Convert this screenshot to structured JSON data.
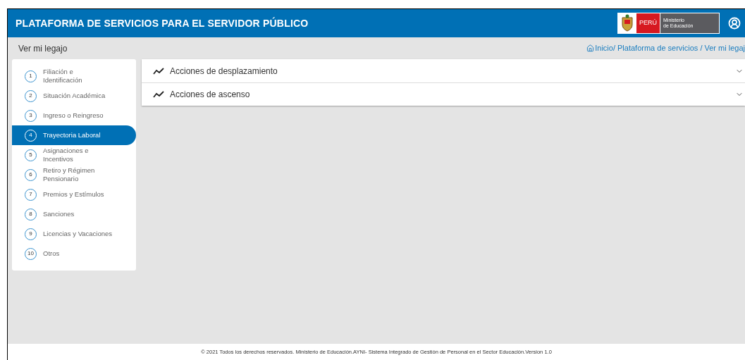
{
  "header": {
    "title": "PLATAFORMA DE SERVICIOS PARA EL SERVIDOR PÚBLICO",
    "logo": {
      "country": "PERÚ",
      "ministry_line_1": "Ministerio",
      "ministry_line_2": "de Educación"
    }
  },
  "subheader": {
    "title": "Ver mi legajo",
    "breadcrumb": "Inicio/ Plataforma de servicios / Ver mi legaj"
  },
  "sidebar": {
    "items": [
      {
        "number": "1",
        "label": "Filiación e Identificación",
        "selected": false
      },
      {
        "number": "2",
        "label": "Situación Académica",
        "selected": false
      },
      {
        "number": "3",
        "label": "Ingreso o Reingreso",
        "selected": false
      },
      {
        "number": "4",
        "label": "Trayectoria Laboral",
        "selected": true
      },
      {
        "number": "5",
        "label": "Asignaciones e Incentivos",
        "selected": false
      },
      {
        "number": "6",
        "label": "Retiro y Régimen Pensionario",
        "selected": false
      },
      {
        "number": "7",
        "label": "Premios y Estímulos",
        "selected": false
      },
      {
        "number": "8",
        "label": "Sanciones",
        "selected": false
      },
      {
        "number": "9",
        "label": "Licencias y Vacaciones",
        "selected": false
      },
      {
        "number": "10",
        "label": "Otros",
        "selected": false
      }
    ]
  },
  "accordion": [
    {
      "label": "Acciones de desplazamiento",
      "expanded": false
    },
    {
      "label": "Acciones de ascenso",
      "expanded": false
    }
  ],
  "footer": "© 2021 Todos los derechos reservados. Ministerio de Educación.AYNI- Sistema Integrado de Gestión de Personal en el Sector Educación.Version 1.0"
}
